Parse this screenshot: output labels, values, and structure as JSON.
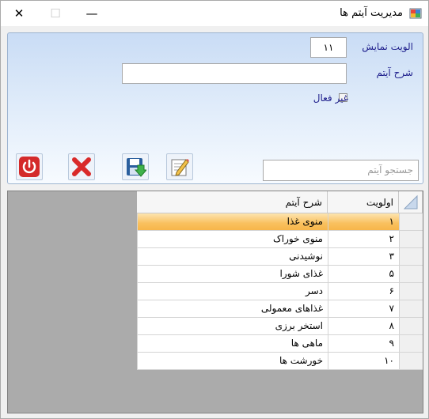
{
  "window": {
    "title": "مدیریت آیتم ها",
    "controls": {
      "minimize": "—",
      "maximize": "☐",
      "close": "✕"
    }
  },
  "form": {
    "priority_label": "الویت نمایش",
    "priority_value": "۱۱",
    "description_label": "شرح آیتم",
    "description_value": "",
    "inactive_label": "غیر فعال",
    "inactive_checked": false,
    "search_placeholder": "جستجو آیتم",
    "buttons": [
      {
        "name": "edit-button",
        "icon": "edit-icon"
      },
      {
        "name": "save-button",
        "icon": "save-icon"
      },
      {
        "name": "delete-button",
        "icon": "delete-icon"
      },
      {
        "name": "exit-button",
        "icon": "power-icon"
      }
    ]
  },
  "grid": {
    "columns": [
      "اولویت",
      "شرح آیتم"
    ],
    "rows": [
      {
        "priority": "۱",
        "description": "منوی غذا",
        "selected": true
      },
      {
        "priority": "۲",
        "description": "منوی خوراک",
        "selected": false
      },
      {
        "priority": "۳",
        "description": "نوشیدنی",
        "selected": false
      },
      {
        "priority": "۵",
        "description": "غذای شورا",
        "selected": false
      },
      {
        "priority": "۶",
        "description": "دسر",
        "selected": false
      },
      {
        "priority": "۷",
        "description": "غذاهای معمولی",
        "selected": false
      },
      {
        "priority": "۸",
        "description": "استخر برزی",
        "selected": false
      },
      {
        "priority": "۹",
        "description": "ماهی ها",
        "selected": false
      },
      {
        "priority": "۱۰",
        "description": "خورشت ها",
        "selected": false
      }
    ]
  },
  "colors": {
    "selection": "#f9c05e",
    "label": "#1e1e8c",
    "panel": "#c9dcf5",
    "grid_background": "#ababab"
  }
}
